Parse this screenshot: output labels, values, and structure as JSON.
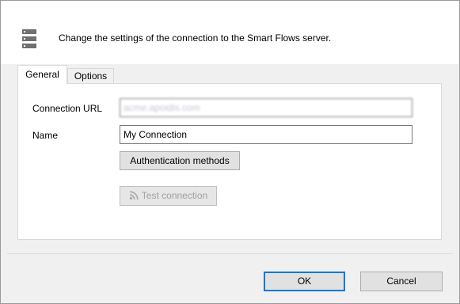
{
  "header": {
    "text": "Change the settings of the connection to the Smart Flows server.",
    "icon": "server-icon"
  },
  "tabs": [
    {
      "label": "General",
      "selected": true
    },
    {
      "label": "Options",
      "selected": false
    }
  ],
  "form": {
    "connection_url_label": "Connection URL",
    "connection_url_value": "acme.apoidis.com",
    "name_label": "Name",
    "name_value": "My Connection",
    "auth_button": "Authentication methods",
    "test_button": "Test connection",
    "test_icon": "rss-icon"
  },
  "footer": {
    "ok": "OK",
    "cancel": "Cancel"
  },
  "colors": {
    "dialog_bg": "#f0f0f0",
    "panel_bg": "#ffffff",
    "accent": "#0078d7",
    "icon_gray": "#707070"
  }
}
